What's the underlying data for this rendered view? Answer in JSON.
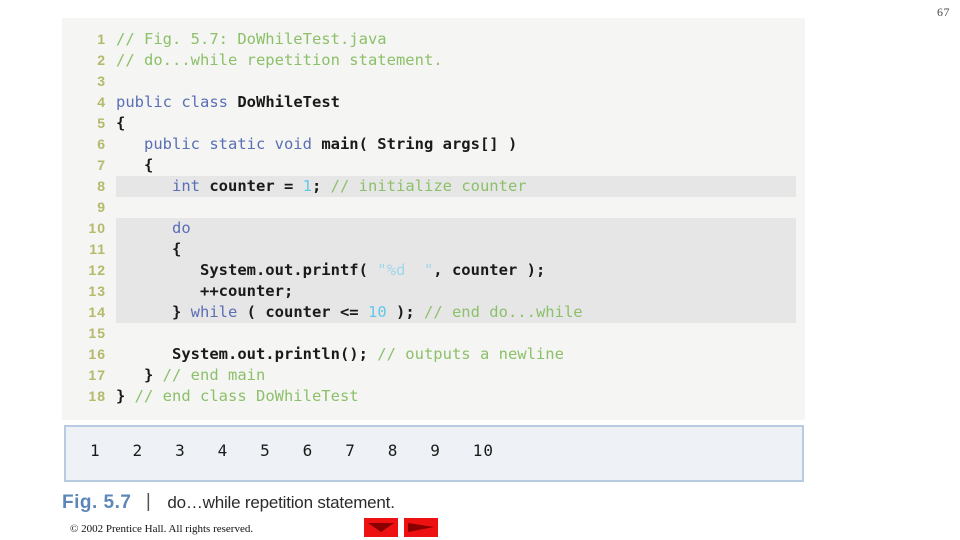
{
  "page": {
    "number": "67"
  },
  "code_panel": {
    "name": "java-source-listing",
    "lines": [
      {
        "n": "1",
        "highlight": false,
        "tokens": [
          {
            "c": "com",
            "t": "// Fig. 5.7: DoWhileTest.java"
          }
        ]
      },
      {
        "n": "2",
        "highlight": false,
        "tokens": [
          {
            "c": "com",
            "t": "// do...while repetition statement."
          }
        ]
      },
      {
        "n": "3",
        "highlight": false,
        "tokens": []
      },
      {
        "n": "4",
        "highlight": false,
        "tokens": [
          {
            "c": "kw",
            "t": "public class "
          },
          {
            "c": "pln",
            "t": "DoWhileTest"
          }
        ]
      },
      {
        "n": "5",
        "highlight": false,
        "tokens": [
          {
            "c": "pln",
            "t": "{"
          }
        ]
      },
      {
        "n": "6",
        "highlight": false,
        "tokens": [
          {
            "c": "pln",
            "t": "   "
          },
          {
            "c": "kw",
            "t": "public static void "
          },
          {
            "c": "pln",
            "t": "main( String args[] )"
          }
        ]
      },
      {
        "n": "7",
        "highlight": false,
        "tokens": [
          {
            "c": "pln",
            "t": "   {"
          }
        ]
      },
      {
        "n": "8",
        "highlight": true,
        "tokens": [
          {
            "c": "pln",
            "t": "      "
          },
          {
            "c": "kw",
            "t": "int "
          },
          {
            "c": "pln",
            "t": "counter = "
          },
          {
            "c": "num",
            "t": "1"
          },
          {
            "c": "pln",
            "t": "; "
          },
          {
            "c": "com",
            "t": "// initialize counter"
          }
        ]
      },
      {
        "n": "9",
        "highlight": false,
        "tokens": []
      },
      {
        "n": "10",
        "highlight": true,
        "tokens": [
          {
            "c": "pln",
            "t": "      "
          },
          {
            "c": "kw",
            "t": "do"
          }
        ]
      },
      {
        "n": "11",
        "highlight": true,
        "tokens": [
          {
            "c": "pln",
            "t": "      {"
          }
        ]
      },
      {
        "n": "12",
        "highlight": true,
        "tokens": [
          {
            "c": "pln",
            "t": "         System.out.printf( "
          },
          {
            "c": "str",
            "t": "\"%d  \""
          },
          {
            "c": "pln",
            "t": ", counter );"
          }
        ]
      },
      {
        "n": "13",
        "highlight": true,
        "tokens": [
          {
            "c": "pln",
            "t": "         ++counter;"
          }
        ]
      },
      {
        "n": "14",
        "highlight": true,
        "tokens": [
          {
            "c": "pln",
            "t": "      } "
          },
          {
            "c": "kw",
            "t": "while "
          },
          {
            "c": "pln",
            "t": "( counter <= "
          },
          {
            "c": "num",
            "t": "10"
          },
          {
            "c": "pln",
            "t": " ); "
          },
          {
            "c": "com",
            "t": "// end do...while"
          }
        ]
      },
      {
        "n": "15",
        "highlight": false,
        "tokens": []
      },
      {
        "n": "16",
        "highlight": false,
        "tokens": [
          {
            "c": "pln",
            "t": "      System.out.println(); "
          },
          {
            "c": "com",
            "t": "// outputs a newline"
          }
        ]
      },
      {
        "n": "17",
        "highlight": false,
        "tokens": [
          {
            "c": "pln",
            "t": "   } "
          },
          {
            "c": "com",
            "t": "// end main"
          }
        ]
      },
      {
        "n": "18",
        "highlight": false,
        "tokens": [
          {
            "c": "pln",
            "t": "} "
          },
          {
            "c": "com",
            "t": "// end class DoWhileTest"
          }
        ]
      }
    ]
  },
  "output_panel": {
    "text": "1   2   3   4   5   6   7   8   9   10",
    "values": [
      "1",
      "2",
      "3",
      "4",
      "5",
      "6",
      "7",
      "8",
      "9",
      "10"
    ]
  },
  "caption": {
    "figure_number": "Fig. 5.7",
    "separator": "|",
    "title": "do…while repetition statement."
  },
  "copyright": "© 2002 Prentice Hall.  All rights reserved.",
  "nav": {
    "prev_label": "previous-slide",
    "next_label": "next-slide"
  },
  "colors": {
    "comment": "#8cc06a",
    "keyword": "#5a6fb5",
    "number": "#63c8e8",
    "string": "#9fd6ea",
    "plain": "#1a1a1a",
    "line_number": "#b5b96a",
    "code_bg": "#f5f5f3",
    "highlight_bg": "#e6e6e6",
    "output_bg": "#eef2f6",
    "output_border": "#b9cbe0",
    "caption_accent": "#5d87b8",
    "nav_red": "#ee1111"
  }
}
